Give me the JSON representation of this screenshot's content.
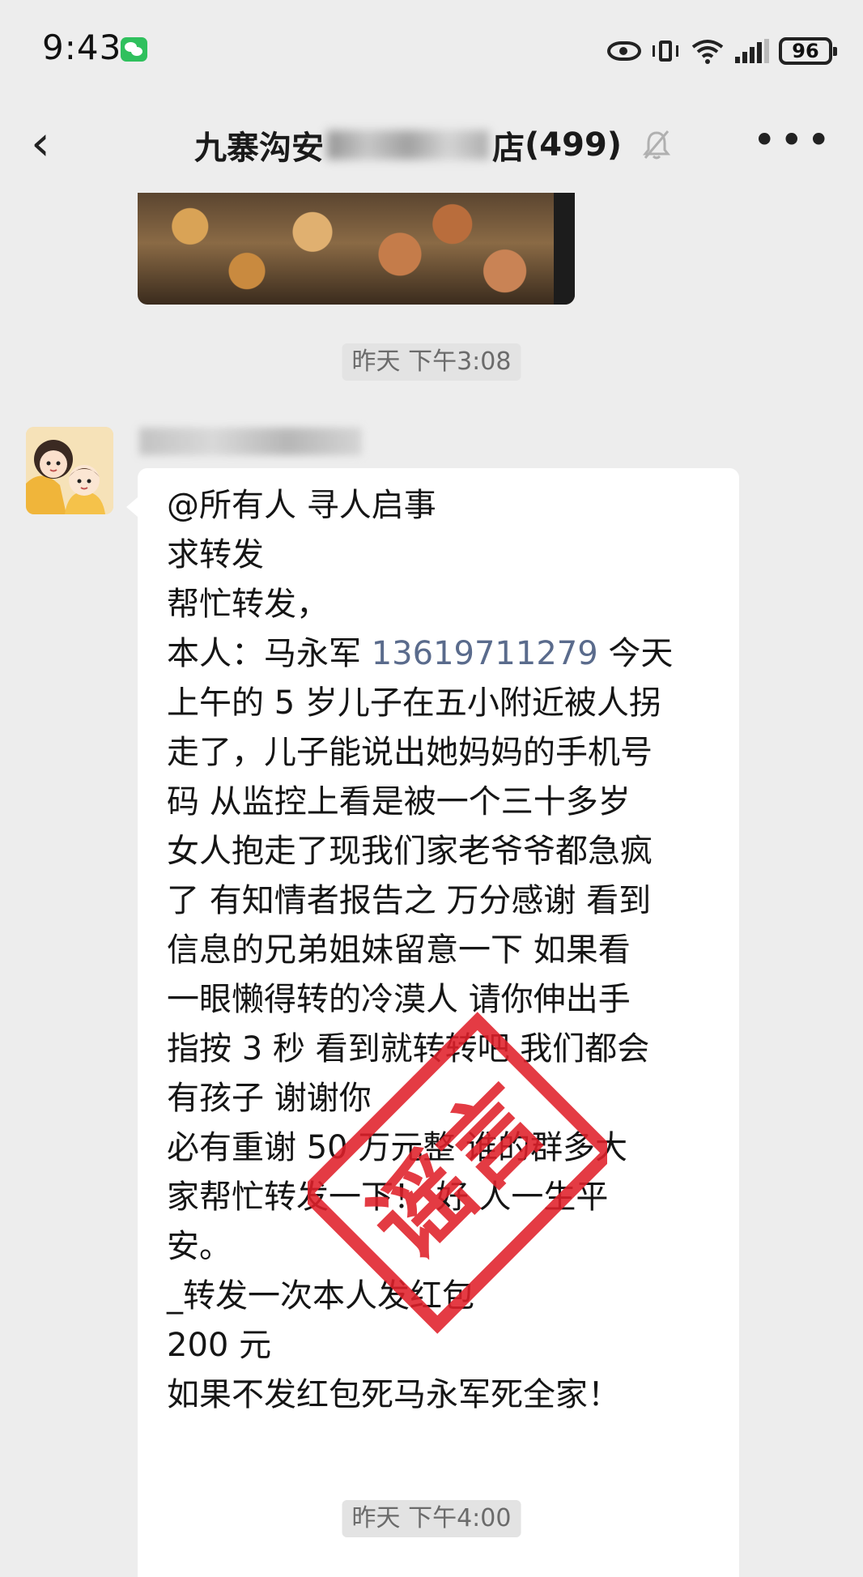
{
  "status_bar": {
    "time": "9:43",
    "battery": "96",
    "icons": [
      "wechat-notification-icon",
      "eye-icon",
      "vibrate-icon",
      "wifi-icon",
      "signal-icon",
      "battery-icon"
    ]
  },
  "header": {
    "title_visible_start": "九寨沟安",
    "title_visible_end": "店",
    "member_count": "(499)",
    "icons": [
      "back-icon",
      "mute-bell-icon",
      "more-icon"
    ]
  },
  "chat": {
    "timestamp_1": "昨天 下午3:08",
    "timestamp_2": "昨天 下午4:00",
    "message": {
      "lines": [
        "@所有人  寻人启事",
        "求转发",
        "",
        "帮忙转发，",
        "本人：马永军 ",
        "上午的 5 岁儿子在五小附近被人拐",
        "走了，儿子能说出她妈妈的手机号",
        "码 从监控上看是被一个三十多岁",
        "女人抱走了现我们家老爷爷都急疯",
        "了 有知情者报告之 万分感谢 看到",
        "信息的兄弟姐妹留意一下 如果看",
        "一眼懒得转的冷漠人 请你伸出手",
        "指按 3 秒 看到就转转吧 我们都会",
        "有孩子 谢谢你",
        "必有重谢  50 万元整  谁的群多大",
        "家帮忙转发一下！ 好 人一生平",
        "安。",
        "_转发一次本人发红包",
        "200 元",
        "如果不发红包死马永军死全家！"
      ],
      "phone_number": "13619711279",
      "after_phone": " 今天"
    },
    "stamp_text": "谣言"
  },
  "colors": {
    "background": "#ededed",
    "bubble": "#ffffff",
    "phone_link": "#5a6b8c",
    "stamp_red": "#e0202a"
  }
}
